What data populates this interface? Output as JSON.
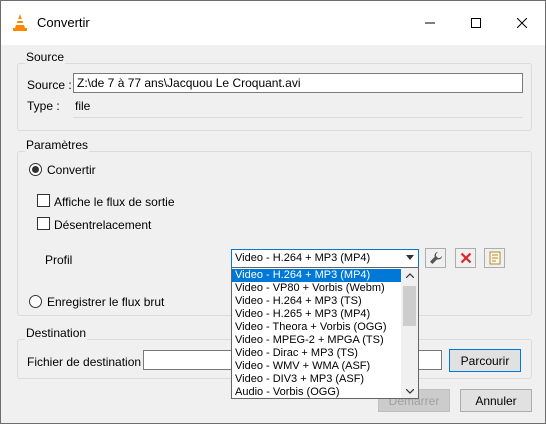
{
  "window": {
    "title": "Convertir"
  },
  "source": {
    "group_title": "Source",
    "source_label": "Source :",
    "source_value": "Z:\\de 7 à 77 ans\\Jacquou Le Croquant.avi",
    "type_label": "Type :",
    "type_value": "file"
  },
  "settings": {
    "group_title": "Paramètres",
    "convert_label": "Convertir",
    "show_output_label": "Affiche le flux de sortie",
    "deinterlace_label": "Désentrelacement",
    "profile_label": "Profil",
    "profile_selected": "Video - H.264 + MP3 (MP4)",
    "raw_dump_label": "Enregistrer le flux brut",
    "profile_options": [
      "Video - H.264 + MP3 (MP4)",
      "Video - VP80 + Vorbis (Webm)",
      "Video - H.264 + MP3 (TS)",
      "Video - H.265 + MP3 (MP4)",
      "Video - Theora + Vorbis (OGG)",
      "Video - MPEG-2 + MPGA (TS)",
      "Video - Dirac + MP3 (TS)",
      "Video - WMV + WMA (ASF)",
      "Video - DIV3 + MP3 (ASF)",
      "Audio - Vorbis (OGG)"
    ]
  },
  "destination": {
    "group_title": "Destination",
    "file_label": "Fichier de destination :",
    "file_value": "",
    "browse_label": "Parcourir"
  },
  "footer": {
    "start_label": "Démarrer",
    "cancel_label": "Annuler"
  },
  "icons": {
    "app": "vlc-cone-icon",
    "edit": "wrench-icon",
    "delete": "red-x-icon",
    "new": "new-profile-icon"
  },
  "colors": {
    "accent": "#0078d7",
    "vlc_orange": "#ff8800",
    "delete_red": "#d9262c"
  }
}
